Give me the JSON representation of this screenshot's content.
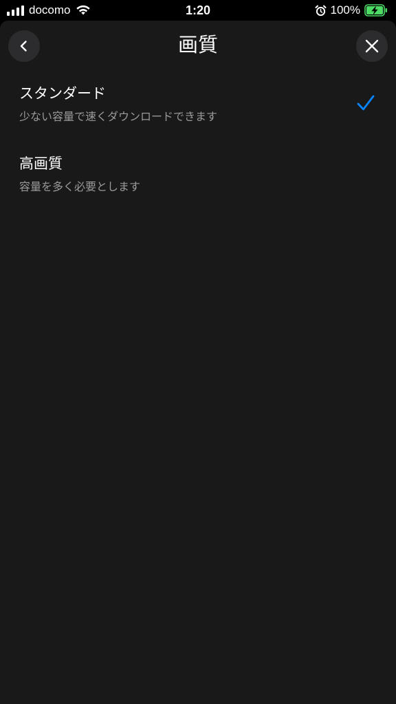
{
  "status_bar": {
    "carrier": "docomo",
    "time": "1:20",
    "battery_percent": "100%",
    "icons": [
      "signal-icon",
      "wifi-icon",
      "alarm-icon",
      "battery-charging-icon"
    ]
  },
  "header": {
    "title": "画質",
    "back_icon": "chevron-left-icon",
    "close_icon": "close-icon"
  },
  "options": [
    {
      "title": "スタンダード",
      "subtitle": "少ない容量で速くダウンロードできます",
      "selected": true
    },
    {
      "title": "高画質",
      "subtitle": "容量を多く必要とします",
      "selected": false
    }
  ],
  "colors": {
    "background": "#191919",
    "accent": "#0a84ff",
    "button_bg": "#2c2c2e",
    "subtitle": "#9a9a9a",
    "battery_charging": "#4cd964"
  }
}
